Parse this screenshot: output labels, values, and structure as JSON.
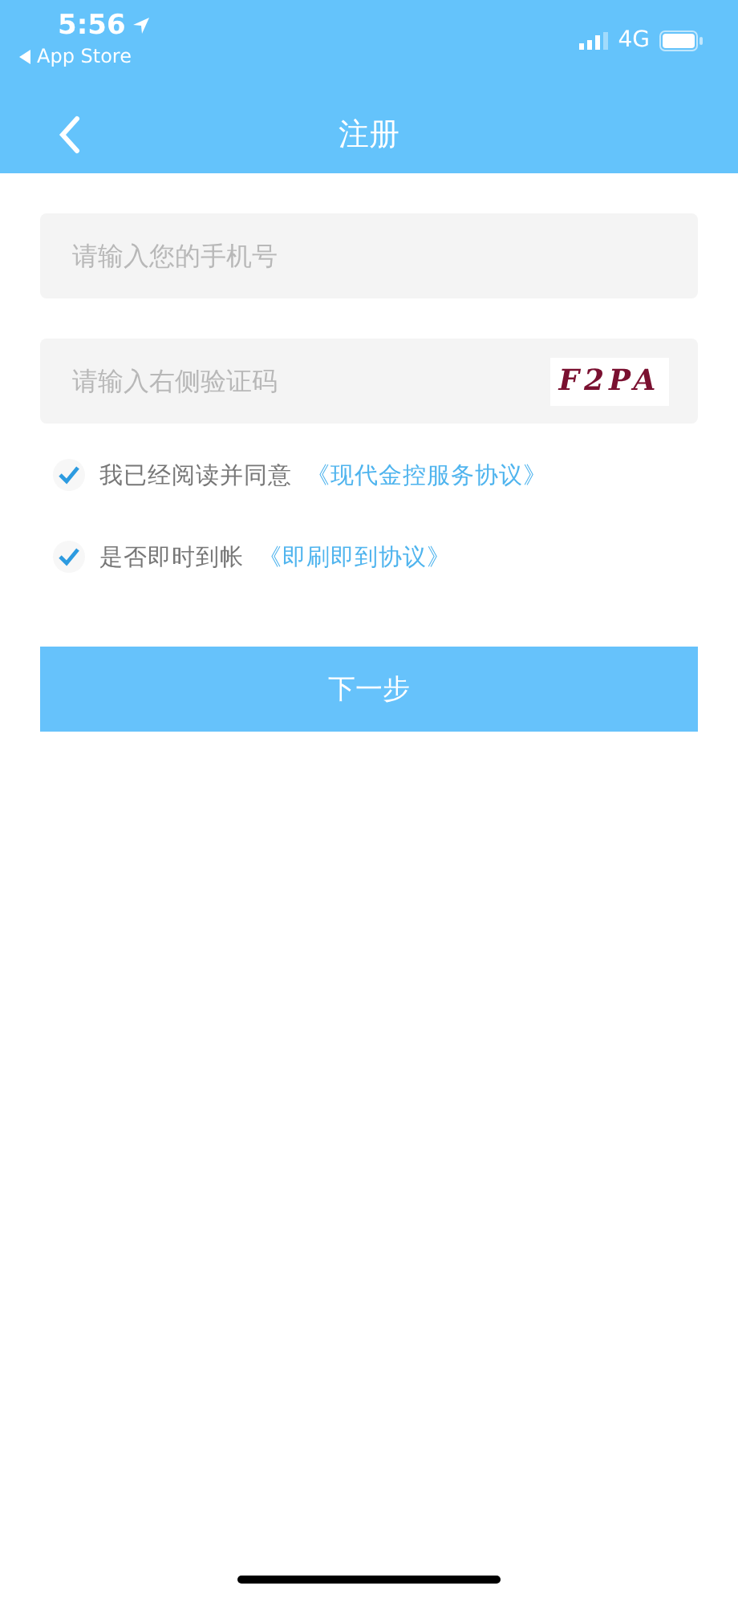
{
  "status_bar": {
    "time": "5:56",
    "back_app": "App Store",
    "network": "4G"
  },
  "nav_bar": {
    "title": "注册"
  },
  "phone_field": {
    "placeholder": "请输入您的手机号"
  },
  "captcha_field": {
    "placeholder": "请输入右侧验证码",
    "captcha": "F2PA"
  },
  "agreements": [
    {
      "checked": true,
      "text": "我已经阅读并同意",
      "link": "《现代金控服务协议》"
    },
    {
      "checked": true,
      "text": "是否即时到帐",
      "link": "《即刷即到协议》"
    }
  ],
  "next_button": {
    "label": "下一步"
  }
}
